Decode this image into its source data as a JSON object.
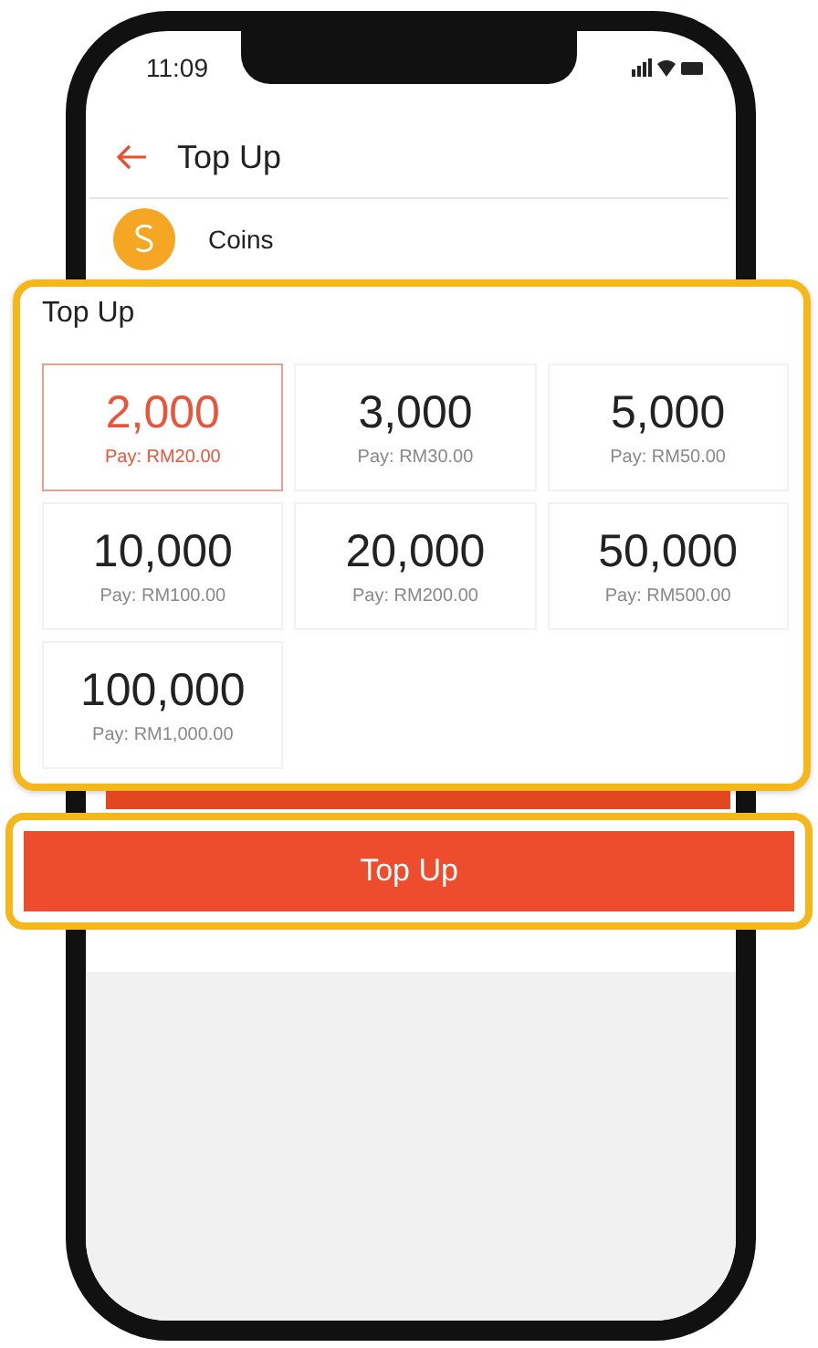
{
  "status_bar": {
    "time": "11:09"
  },
  "header": {
    "title": "Top Up"
  },
  "balance": {
    "label": "Coins"
  },
  "top_up_panel": {
    "title": "Top Up",
    "options": [
      {
        "amount": "2,000",
        "price": "Pay: RM20.00",
        "selected": true
      },
      {
        "amount": "3,000",
        "price": "Pay: RM30.00",
        "selected": false
      },
      {
        "amount": "5,000",
        "price": "Pay: RM50.00",
        "selected": false
      },
      {
        "amount": "10,000",
        "price": "Pay: RM100.00",
        "selected": false
      },
      {
        "amount": "20,000",
        "price": "Pay: RM200.00",
        "selected": false
      },
      {
        "amount": "50,000",
        "price": "Pay: RM500.00",
        "selected": false
      },
      {
        "amount": "100,000",
        "price": "Pay: RM1,000.00",
        "selected": false
      }
    ]
  },
  "button": {
    "label": "Top Up"
  }
}
